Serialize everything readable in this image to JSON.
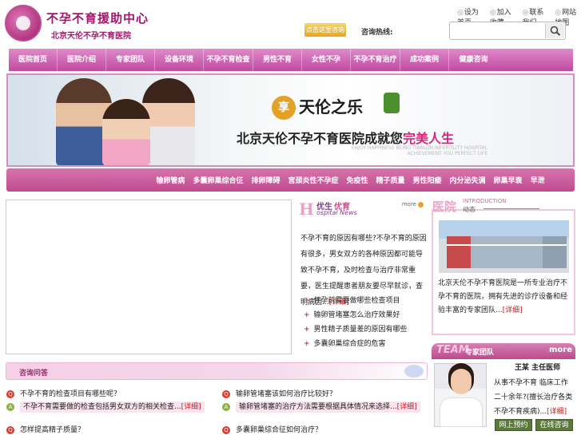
{
  "header": {
    "logo_title": "不孕不育援助中心",
    "logo_subtitle": "北京天伦不孕不育医院",
    "badge": "点击这里咨询",
    "hotline_label": "咨询热线:",
    "hotline_value": "",
    "top_links": [
      "设为首页",
      "加入收藏",
      "联系我们",
      "网站地图"
    ],
    "search_placeholder": ""
  },
  "nav_main": [
    "医院首页",
    "医院介绍",
    "专家团队",
    "设备环境",
    "不孕不育检查",
    "男性不育",
    "女性不孕",
    "不孕不育治疗",
    "成功案例",
    "健康咨询"
  ],
  "banner": {
    "enjoy": "享",
    "slogan1": "天伦之乐",
    "slogan2_a": "北京天伦不孕不育医院成就您",
    "slogan2_b": "完美人生",
    "eng1": "ENJOY HAPPINESS BEING TIANLUN INFERTILITY HOSPITAL",
    "eng2": "ACHIEVEMENT YOU PERFECT LIFE"
  },
  "nav_sub": [
    "输卵管病",
    "多囊卵巢综合征",
    "排卵障碍",
    "宫颈炎性不孕症",
    "免疫性",
    "精子质量",
    "男性阳痿",
    "内分泌失调",
    "卵巢早衰",
    "早泄"
  ],
  "news": {
    "title_big": "H",
    "title_zh1": "优生",
    "title_zh2": "优育",
    "title_en": "ospital News",
    "more": "more",
    "text": "不孕不育的原因有哪些?不孕不育的原因有很多，男女双方的各种原因都可能导致不孕不育，及时检查与治疗非常重要，医生提醒患者朋友要尽早就诊，查明病因...",
    "detail_link": "[详细]",
    "items": [
      "怀孕前需要做哪些检查项目",
      "输卵管堵塞怎么治疗效果好",
      "男性精子质量差的原因有哪些",
      "多囊卵巢综合症的危害"
    ]
  },
  "intro": {
    "title_zh": "医院",
    "title_en": "INTRODUCTION",
    "title_zh2": "动态",
    "text": "北京天伦不孕不育医院是一所专业治疗不孕不育的医院，拥有先进的诊疗设备和经验丰富的专家团队...",
    "detail_link": "[详细]"
  },
  "team": {
    "tm": "TEAM",
    "label": "专家团队",
    "more": "more",
    "doctor_name": "王某 主任医师",
    "doctor_desc": "从事不孕不育 临床工作二十余年?(擅长治疗各类不孕不育疾病)...",
    "detail_link": "[详细]",
    "btn_appointment": "网上预约",
    "btn_consult": "在线咨询"
  },
  "qa": {
    "title": "咨询问答",
    "rows": [
      {
        "q": "不孕不育的检查项目有哪些呢？",
        "a": "不孕不育需要做的检查包括男女双方的相关检查...",
        "a_link": "[详细]"
      },
      {
        "q": "输卵管堵塞该如何治疗比较好？",
        "a": "输卵管堵塞的治疗方法需要根据具体情况来选择...",
        "a_link": "[详细]"
      },
      {
        "q": "怎样提高精子质量？",
        "q2": "多囊卵巢综合征如何治疗？"
      }
    ]
  }
}
